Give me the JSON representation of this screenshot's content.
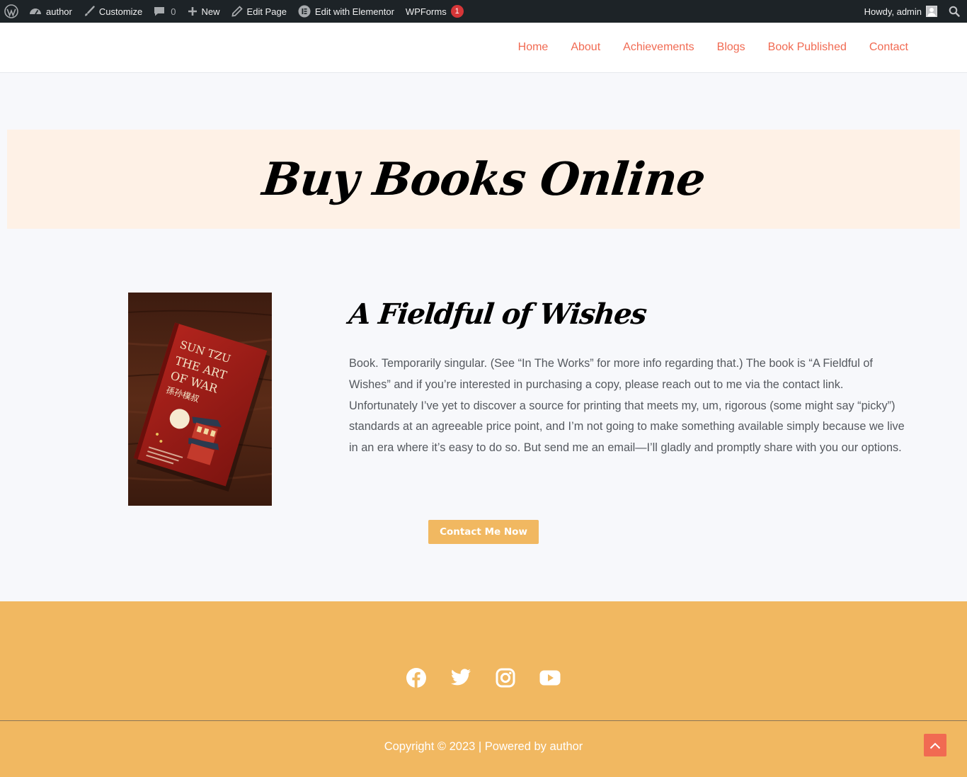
{
  "admin_bar": {
    "site_name": "author",
    "customize": "Customize",
    "comments_count": "0",
    "new": "New",
    "edit_page": "Edit Page",
    "edit_elementor": "Edit with Elementor",
    "wpforms": "WPForms",
    "wpforms_badge": "1",
    "howdy": "Howdy, admin"
  },
  "nav": {
    "items": [
      "Home",
      "About",
      "Achievements",
      "Blogs",
      "Book Published",
      "Contact"
    ]
  },
  "hero": {
    "title": "Buy Books Online"
  },
  "book": {
    "cover_text": {
      "author": "SUN TZU",
      "title_line1": "THE ART",
      "title_line2": "OF WAR",
      "chinese": "孫孙樸叔"
    },
    "title": "A Fieldful of Wishes",
    "description": "Book. Temporarily singular. (See “In The Works” for more info regarding that.) The book is “A Fieldful of Wishes” and if you’re interested in purchasing a copy, please reach out to me via the contact link. Unfortunately I’ve yet to discover a source for printing that meets my, um, rigorous (some might say “picky”) standards at an agreeable price point, and I’m not going to make something available simply because we live in an era where it’s easy to do so. But send me an email—I’ll gladly and promptly share with you our options.",
    "cta": "Contact Me Now"
  },
  "footer": {
    "socials": [
      "facebook-icon",
      "twitter-icon",
      "instagram-icon",
      "youtube-icon"
    ],
    "copyright": "Copyright © 2023 | Powered by author"
  },
  "colors": {
    "accent": "#f16a52",
    "footer_bg": "#f1b861",
    "hero_bg": "#fef1e6",
    "admin_bar": "#1d2327"
  }
}
